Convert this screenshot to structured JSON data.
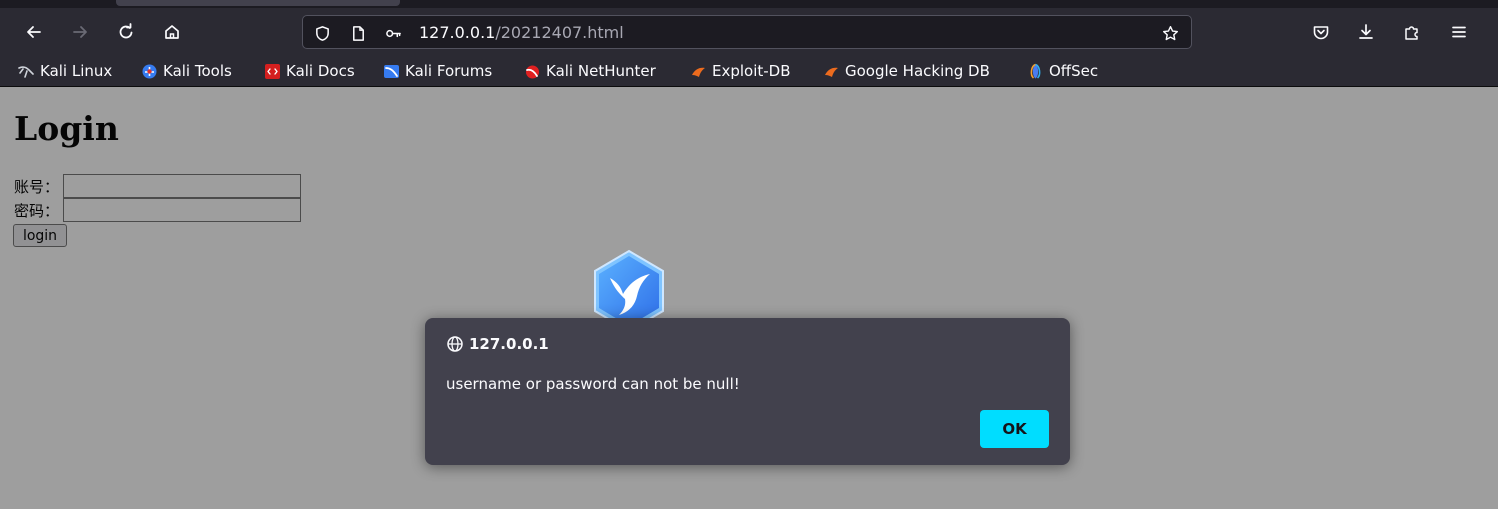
{
  "toolbar": {
    "url_host": "127.0.0.1",
    "url_path": "/20212407.html"
  },
  "bookmarks": [
    {
      "label": "Kali Linux",
      "icon": "kali-dragon-icon"
    },
    {
      "label": "Kali Tools",
      "icon": "kali-tools-icon"
    },
    {
      "label": "Kali Docs",
      "icon": "kali-docs-icon"
    },
    {
      "label": "Kali Forums",
      "icon": "kali-forums-icon"
    },
    {
      "label": "Kali NetHunter",
      "icon": "kali-nethunter-icon"
    },
    {
      "label": "Exploit-DB",
      "icon": "exploit-db-icon"
    },
    {
      "label": "Google Hacking DB",
      "icon": "google-hacking-db-icon"
    },
    {
      "label": "OffSec",
      "icon": "offsec-icon"
    }
  ],
  "page": {
    "title": "Login",
    "account_label": "账号：",
    "password_label": "密码：",
    "account_value": "",
    "password_value": "",
    "login_button": "login"
  },
  "alert": {
    "origin": "127.0.0.1",
    "message": "username or password can not be null!",
    "ok_label": "OK"
  },
  "colors": {
    "chrome_bg": "#2b2a33",
    "dialog_bg": "#42414d",
    "accent": "#00ddff"
  }
}
